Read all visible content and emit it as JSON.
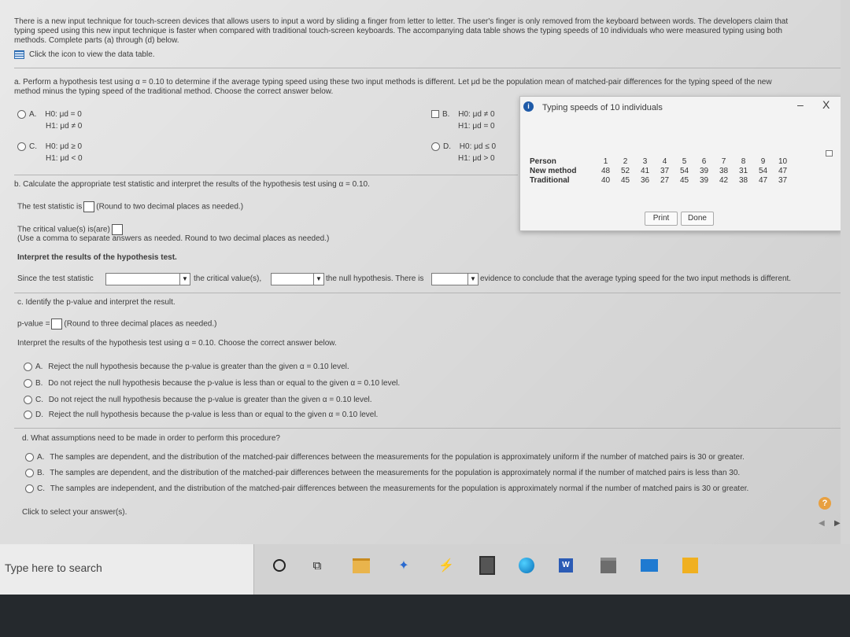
{
  "intro": {
    "line1": "There is a new input technique for touch-screen devices that allows users to input a word by sliding a finger from letter to letter. The user's finger is only removed from the keyboard between words. The developers claim that",
    "line2": "typing speed using this new input technique is faster when compared with traditional touch-screen keyboards. The accompanying data table shows the typing speeds of 10 individuals who were measured typing using both",
    "line3": "methods. Complete parts (a) through (d) below.",
    "data_link": "Click the icon to view the data table."
  },
  "part_a": {
    "line1": "a. Perform a hypothesis test using α = 0.10 to determine if the average typing speed using these two input methods is different. Let μd be the population mean of matched-pair differences for the typing speed of the new",
    "line2": "method minus the typing speed of the traditional method. Choose the correct answer below.",
    "options": [
      {
        "letter": "A.",
        "h0": "H0: μd = 0",
        "h1": "H1: μd ≠ 0"
      },
      {
        "letter": "B.",
        "h0": "H0: μd ≠ 0",
        "h1": "H1: μd = 0"
      },
      {
        "letter": "C.",
        "h0": "H0: μd ≥ 0",
        "h1": "H1: μd < 0"
      },
      {
        "letter": "D.",
        "h0": "H0: μd ≤ 0",
        "h1": "H1: μd > 0"
      }
    ]
  },
  "part_b": {
    "prompt": "b. Calculate the appropriate test statistic and interpret the results of the hypothesis test using α = 0.10.",
    "stat_label": "The test statistic is",
    "stat_hint": "(Round to two decimal places as needed.)",
    "crit_label": "The critical value(s) is(are)",
    "crit_hint": "(Use a comma to separate answers as needed. Round to two decimal places as needed.)",
    "interpret": "Interpret the results of the hypothesis test.",
    "since": "Since the test statistic",
    "crit_mid": "the critical value(s),",
    "null_mid": "the null hypothesis. There is",
    "evidence": "evidence to conclude that the average typing speed for the two input methods is different."
  },
  "part_c": {
    "prompt": "c. Identify the p-value and interpret the result.",
    "pval_label": "p-value =",
    "pval_hint": "(Round to three decimal places as needed.)",
    "interpret": "Interpret the results of the hypothesis test using α = 0.10. Choose the correct answer below.",
    "options": [
      {
        "letter": "A.",
        "text": "Reject the null hypothesis because the p-value is greater than the given α = 0.10 level."
      },
      {
        "letter": "B.",
        "text": "Do not reject the null hypothesis because the p-value is less than or equal to the given α = 0.10 level."
      },
      {
        "letter": "C.",
        "text": "Do not reject the null hypothesis because the p-value is greater than the given α = 0.10 level."
      },
      {
        "letter": "D.",
        "text": "Reject the null hypothesis because the p-value is less than or equal to the given α = 0.10 level."
      }
    ]
  },
  "part_d": {
    "prompt": "d. What assumptions need to be made in order to perform this procedure?",
    "options": [
      {
        "letter": "A.",
        "text": "The samples are dependent, and the distribution of the matched-pair differences between the measurements for the population is approximately uniform if the number of matched pairs is 30 or greater."
      },
      {
        "letter": "B.",
        "text": "The samples are dependent, and the distribution of the matched-pair differences between the measurements for the population is approximately normal if the number of matched pairs is less than 30."
      },
      {
        "letter": "C.",
        "text": "The samples are independent, and the distribution of the matched-pair differences between the measurements for the population is approximately normal if the number of matched pairs is 30 or greater."
      }
    ],
    "footer": "Click to select your answer(s)."
  },
  "popup": {
    "title": "Typing speeds of 10 individuals",
    "close": "X",
    "minimize": "–",
    "info_icon": "info-icon",
    "headers": [
      "Person",
      "1",
      "2",
      "3",
      "4",
      "5",
      "6",
      "7",
      "8",
      "9",
      "10"
    ],
    "rows": [
      {
        "label": "New method",
        "values": [
          "48",
          "52",
          "41",
          "37",
          "54",
          "39",
          "38",
          "31",
          "54",
          "47"
        ]
      },
      {
        "label": "Traditional",
        "values": [
          "40",
          "45",
          "36",
          "27",
          "45",
          "39",
          "42",
          "38",
          "47",
          "37"
        ]
      }
    ],
    "print": "Print",
    "done": "Done"
  },
  "taskbar": {
    "search_placeholder": "Type here to search",
    "icons": [
      "cortana-circle-icon",
      "task-view-icon",
      "file-explorer-icon",
      "dropbox-icon",
      "bolt-app-icon",
      "calculator-icon",
      "edge-browser-icon",
      "word-icon",
      "store-icon",
      "mail-icon",
      "sticky-notes-icon"
    ]
  },
  "colors": {
    "accent": "#1a4f9c",
    "help": "#e8a040"
  }
}
